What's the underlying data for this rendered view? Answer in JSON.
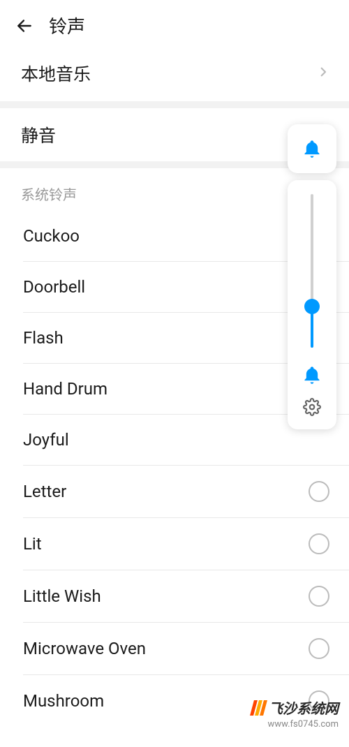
{
  "header": {
    "title": "铃声"
  },
  "local_music": {
    "label": "本地音乐"
  },
  "mute": {
    "label": "静音"
  },
  "section": {
    "title": "系统铃声"
  },
  "ringtones": [
    {
      "name": "Cuckoo",
      "show_radio": false
    },
    {
      "name": "Doorbell",
      "show_radio": false
    },
    {
      "name": "Flash",
      "show_radio": false
    },
    {
      "name": "Hand Drum",
      "show_radio": false
    },
    {
      "name": "Joyful",
      "show_radio": false
    },
    {
      "name": "Letter",
      "show_radio": true
    },
    {
      "name": "Lit",
      "show_radio": true
    },
    {
      "name": "Little Wish",
      "show_radio": true
    },
    {
      "name": "Microwave Oven",
      "show_radio": true
    },
    {
      "name": "Mushroom",
      "show_radio": true
    }
  ],
  "volume": {
    "percent": 27
  },
  "watermark": {
    "text": "飞沙系统网",
    "url": "www.fs0745.com"
  },
  "colors": {
    "accent": "#0099ff"
  }
}
